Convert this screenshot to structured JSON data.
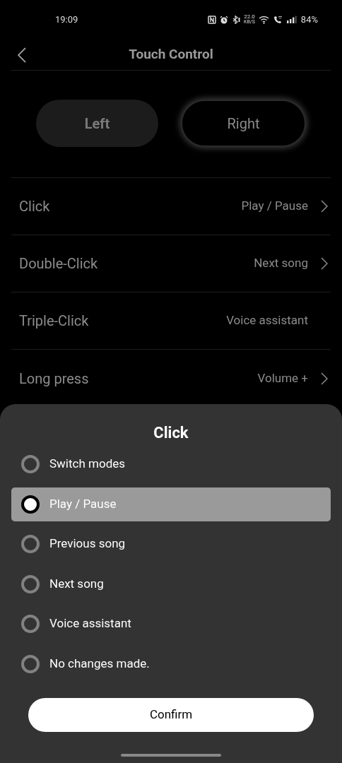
{
  "status_bar": {
    "time": "19:09",
    "speed_value": "22.0",
    "speed_unit": "KB/S",
    "battery": "84%"
  },
  "header": {
    "title": "Touch Control"
  },
  "sides": [
    {
      "label": "Left",
      "selected": false
    },
    {
      "label": "Right",
      "selected": true
    }
  ],
  "settings": [
    {
      "label": "Click",
      "value": "Play / Pause",
      "has_chevron": true
    },
    {
      "label": "Double-Click",
      "value": "Next song",
      "has_chevron": true
    },
    {
      "label": "Triple-Click",
      "value": "Voice assistant",
      "has_chevron": false
    },
    {
      "label": "Long press",
      "value": "Volume +",
      "has_chevron": true
    }
  ],
  "sheet": {
    "title": "Click",
    "options": [
      {
        "label": "Switch modes",
        "selected": false
      },
      {
        "label": "Play / Pause",
        "selected": true
      },
      {
        "label": "Previous song",
        "selected": false
      },
      {
        "label": "Next song",
        "selected": false
      },
      {
        "label": "Voice assistant",
        "selected": false
      },
      {
        "label": "No changes made.",
        "selected": false
      }
    ],
    "confirm": "Confirm"
  }
}
